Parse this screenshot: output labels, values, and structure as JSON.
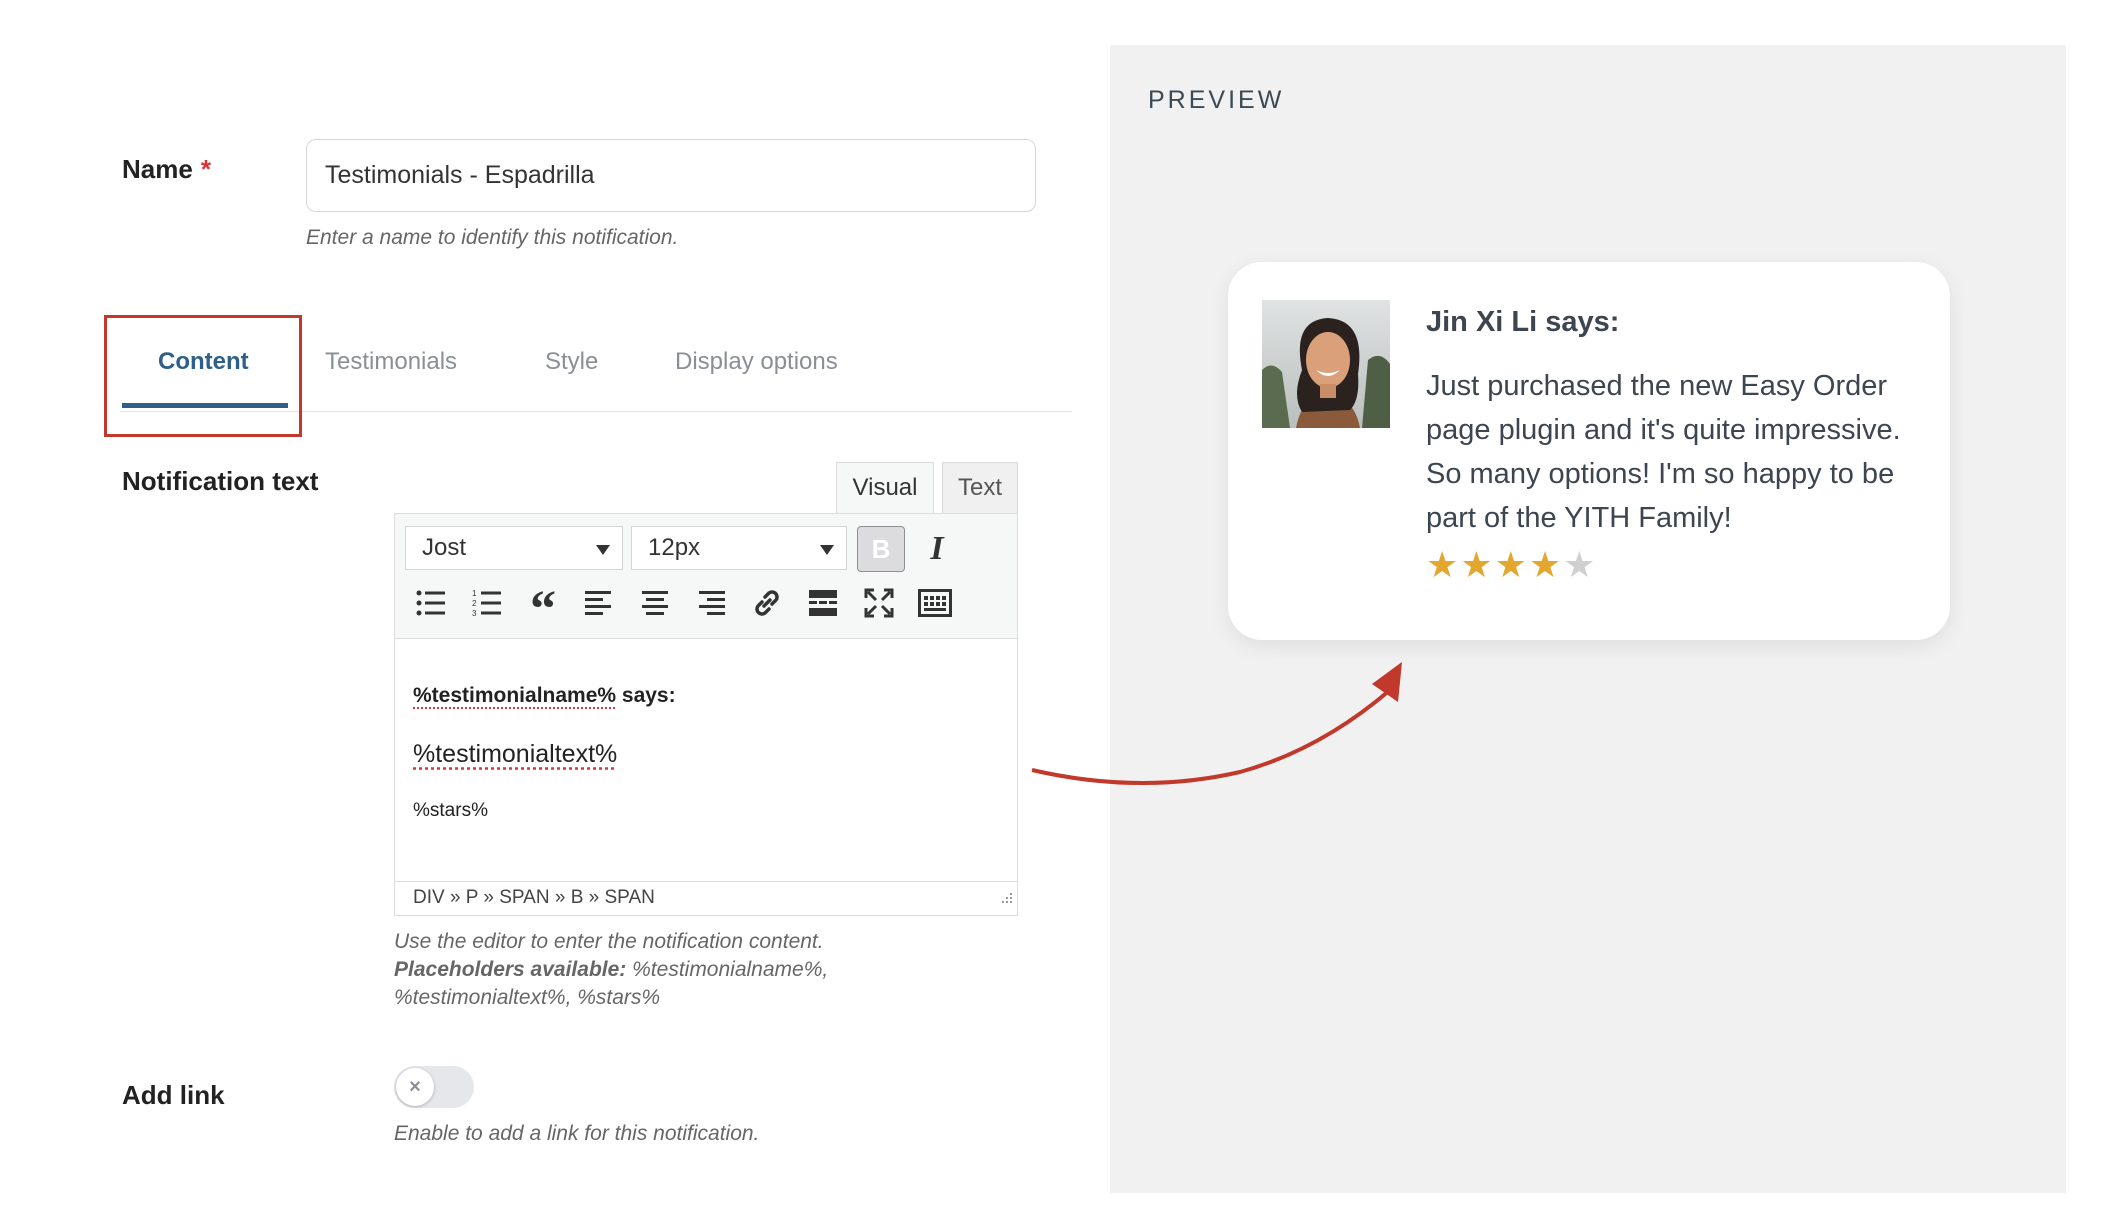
{
  "form": {
    "name_label": "Name",
    "required_mark": "*",
    "name_value": "Testimonials - Espadrilla",
    "name_help": "Enter a name to identify this notification."
  },
  "tabs": [
    {
      "label": "Content",
      "active": true
    },
    {
      "label": "Testimonials",
      "active": false
    },
    {
      "label": "Style",
      "active": false
    },
    {
      "label": "Display options",
      "active": false
    }
  ],
  "notification": {
    "label": "Notification text",
    "editor_tabs": [
      "Visual",
      "Text"
    ],
    "font_select": "Jost",
    "size_select": "12px",
    "bold_label": "B",
    "italic_label": "I",
    "line1_placeholder": "%testimonialname%",
    "line1_suffix": " says:",
    "line2": "%testimonialtext%",
    "line3": "%stars%",
    "status_path": "DIV » P » SPAN » B » SPAN",
    "help_line1": "Use the editor to enter the notification content.",
    "help_placeholders_label": "Placeholders available:",
    "help_placeholders_1": " %testimonialname%,",
    "help_placeholders_2": "%testimonialtext%, %stars%"
  },
  "add_link": {
    "label": "Add link",
    "toggle_on": false,
    "help": "Enable to add a link for this notification."
  },
  "preview": {
    "title": "PREVIEW",
    "author": "Jin Xi Li says:",
    "text": "Just purchased the new Easy Order page plugin and it's quite impressive. So many options! I'm so happy to be part of the YITH Family!",
    "rating": 4,
    "max_rating": 5,
    "star_color": "#e3a72f",
    "star_empty_color": "#d0d0d0"
  },
  "colors": {
    "accent": "#2d5f8a",
    "highlight": "#c0392b",
    "required": "#d63638"
  }
}
